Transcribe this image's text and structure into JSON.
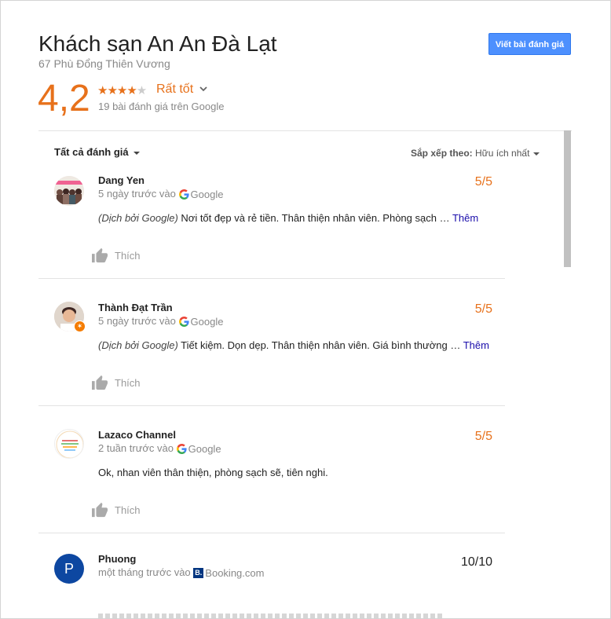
{
  "header": {
    "title": "Khách sạn An An Đà Lạt",
    "address": "67 Phù Đổng Thiên Vương",
    "write_review": "Viết bài đánh giá",
    "rating": "4,2",
    "stars_filled": 4,
    "stars_total": 5,
    "rating_word": "Rất tốt",
    "review_count": "19 bài đánh giá trên Google"
  },
  "toolbar": {
    "filter": "Tất cả đánh giá",
    "sort_label": "Sắp xếp theo:",
    "sort_value": "Hữu ích nhất"
  },
  "reviews": [
    {
      "author": "Dang Yen",
      "time": "5 ngày trước vào",
      "source": "Google",
      "score": "5/5",
      "translated_prefix": "(Dịch bởi Google)",
      "text": " Nơi tốt đẹp và rẻ tiền. Thân thiện nhân viên. Phòng sạch … ",
      "more": "Thêm",
      "like": "Thích"
    },
    {
      "author": "Thành Đạt Trần",
      "time": "5 ngày trước vào",
      "source": "Google",
      "score": "5/5",
      "translated_prefix": "(Dịch bởi Google)",
      "text": " Tiết kiệm. Dọn dẹp. Thân thiện nhân viên. Giá bình thường … ",
      "more": "Thêm",
      "like": "Thích"
    },
    {
      "author": "Lazaco Channel",
      "time": "2 tuần trước vào",
      "source": "Google",
      "score": "5/5",
      "text": "Ok, nhan viên thân thiện, phòng sạch sẽ, tiên nghi.",
      "like": "Thích"
    },
    {
      "author": "Phuong",
      "avatar_letter": "P",
      "time": "một tháng trước vào",
      "source": "Booking.com",
      "source_badge": "B.",
      "score": "10/10"
    }
  ],
  "colors": {
    "accent": "#e7711b",
    "button": "#4d90fe",
    "link": "#1a0dab"
  }
}
